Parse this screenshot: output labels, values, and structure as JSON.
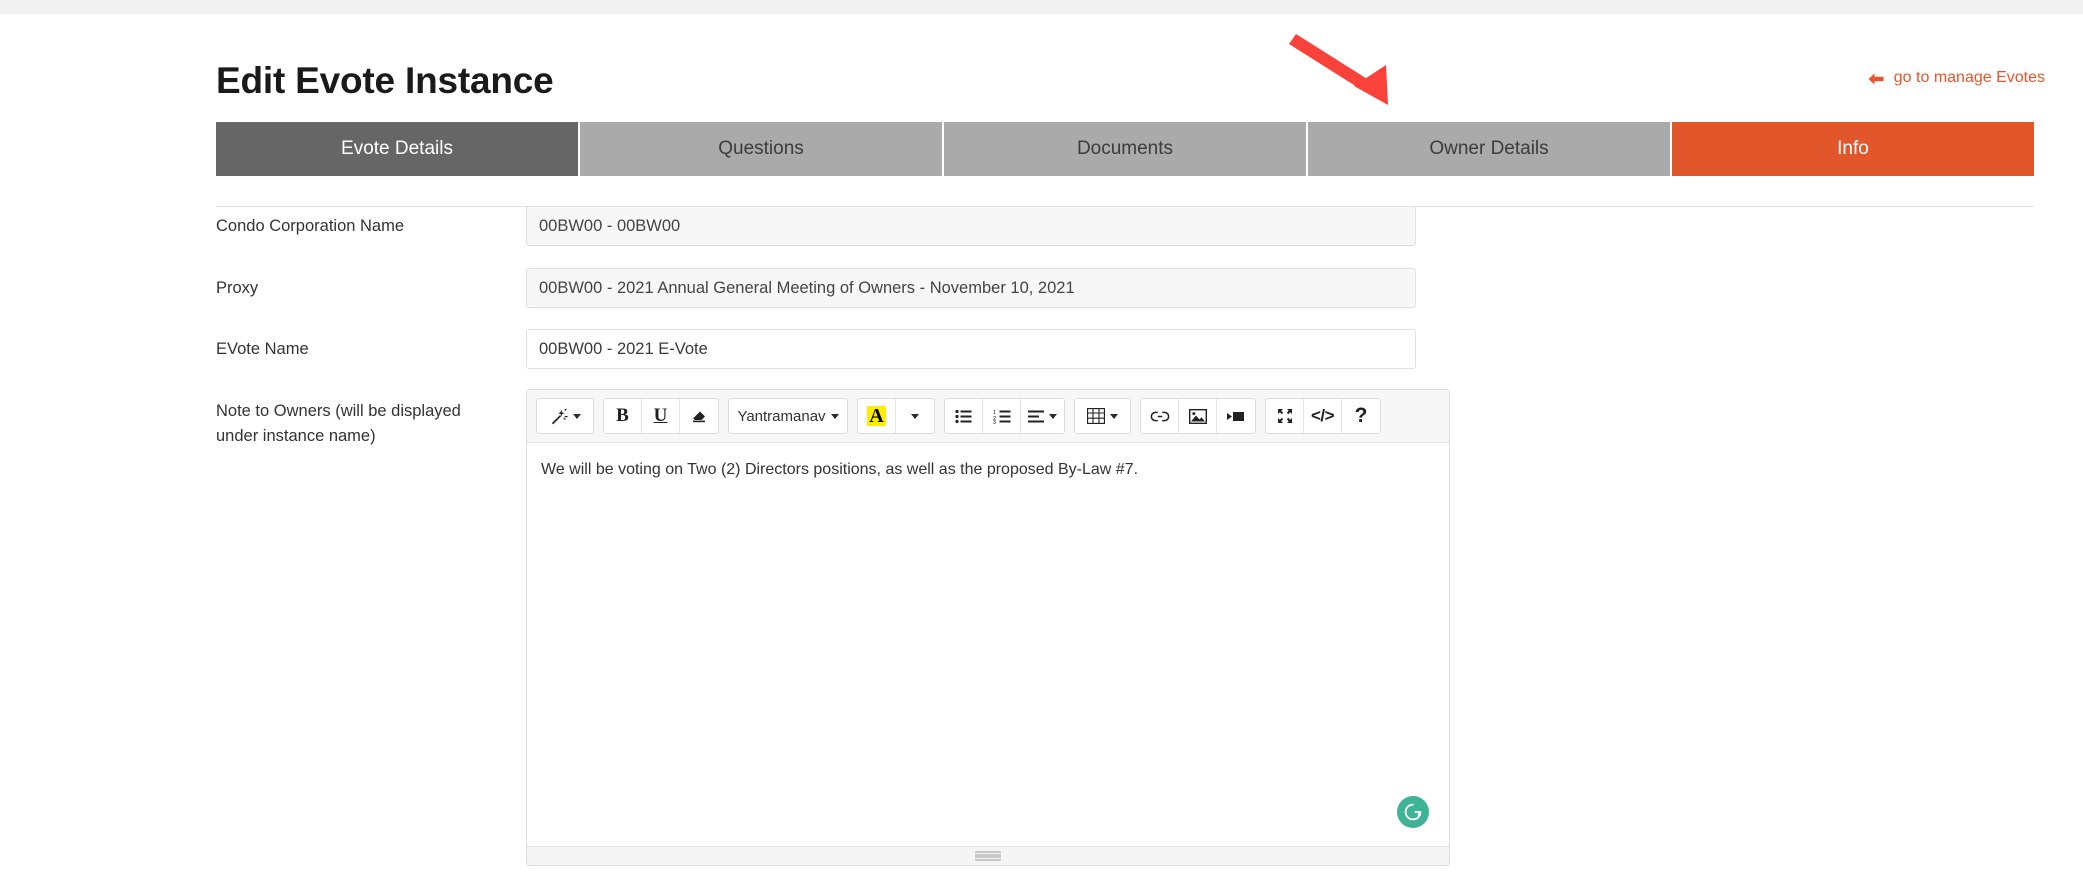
{
  "header": {
    "title": "Edit Evote Instance",
    "manage_link_label": "go to manage Evotes",
    "manage_link_icon": "arrow-left-icon",
    "accent_color": "#e8552d"
  },
  "tabs": [
    {
      "label": "Evote Details",
      "state": "active",
      "color": "#666666"
    },
    {
      "label": "Questions",
      "state": "inactive",
      "color": "#aaaaaa"
    },
    {
      "label": "Documents",
      "state": "inactive",
      "color": "#aaaaaa"
    },
    {
      "label": "Owner Details",
      "state": "inactive",
      "color": "#aaaaaa"
    },
    {
      "label": "Info",
      "state": "highlight",
      "color": "#e2562c"
    }
  ],
  "form": {
    "fields": [
      {
        "label": "Condo Corporation Name",
        "value": "00BW00 - 00BW00",
        "readonly": true
      },
      {
        "label": "Proxy",
        "value": "00BW00 - 2021 Annual General Meeting of Owners - November 10, 2021",
        "readonly": true
      },
      {
        "label": "EVote Name",
        "value": "00BW00 - 2021 E-Vote",
        "readonly": false
      }
    ],
    "note_field": {
      "label_line1": "Note to Owners (will be displayed",
      "label_line2": "under instance name)",
      "content": "We will be voting on Two (2) Directors positions, as well as the proposed By-Law #7."
    }
  },
  "editor": {
    "toolbar": {
      "groups": [
        {
          "buttons": [
            {
              "name": "magic-wand-icon",
              "label": "",
              "caret": true
            }
          ]
        },
        {
          "buttons": [
            {
              "name": "bold-icon",
              "label": "B",
              "caret": false
            },
            {
              "name": "underline-icon",
              "label": "U",
              "caret": false
            },
            {
              "name": "eraser-icon",
              "label": "",
              "caret": false
            }
          ]
        },
        {
          "buttons": [
            {
              "name": "font-family-dropdown",
              "label": "Yantramanav",
              "caret": true
            }
          ]
        },
        {
          "buttons": [
            {
              "name": "text-highlight-color-icon",
              "label": "A",
              "caret": false
            },
            {
              "name": "color-dropdown-caret-icon",
              "label": "",
              "caret": true
            }
          ]
        },
        {
          "buttons": [
            {
              "name": "unordered-list-icon",
              "label": "",
              "caret": false
            },
            {
              "name": "ordered-list-icon",
              "label": "",
              "caret": false
            },
            {
              "name": "paragraph-align-icon",
              "label": "",
              "caret": true
            }
          ]
        },
        {
          "buttons": [
            {
              "name": "table-icon",
              "label": "",
              "caret": true
            }
          ]
        },
        {
          "buttons": [
            {
              "name": "link-icon",
              "label": "",
              "caret": false
            },
            {
              "name": "image-icon",
              "label": "",
              "caret": false
            },
            {
              "name": "video-icon",
              "label": "",
              "caret": false
            }
          ]
        },
        {
          "buttons": [
            {
              "name": "fullscreen-icon",
              "label": "",
              "caret": false
            },
            {
              "name": "code-view-icon",
              "label": "</>",
              "caret": false
            },
            {
              "name": "help-icon",
              "label": "?",
              "caret": false
            }
          ]
        }
      ]
    },
    "grammarly_icon": "grammarly-icon",
    "resize_handle": "editor-resize-handle"
  },
  "annotation": {
    "arrow": "red-annotation-arrow",
    "color": "#f9423a",
    "points_to": "Owner Details"
  }
}
